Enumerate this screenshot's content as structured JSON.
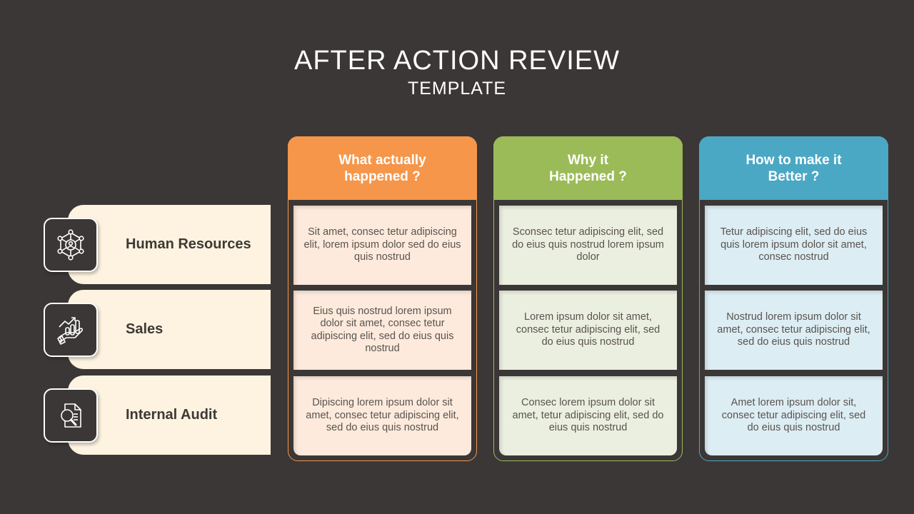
{
  "title": "AFTER ACTION REVIEW",
  "subtitle": "TEMPLATE",
  "colors": {
    "background": "#3b3736",
    "row_label_bg": "#fdf3e0",
    "orange": "#f5964a",
    "green": "#9bbb59",
    "blue": "#4aa8c4",
    "orange_cell": "#fdeadc",
    "green_cell": "#ebefdf",
    "blue_cell": "#dcedf3"
  },
  "rows": [
    {
      "label": "Human Resources",
      "icon": "network-people-icon"
    },
    {
      "label": "Sales",
      "icon": "hand-growth-chart-icon"
    },
    {
      "label": "Internal Audit",
      "icon": "document-search-icon"
    }
  ],
  "columns": [
    {
      "header": "What actually\nhappened ?",
      "cells": [
        "Sit amet, consec tetur adipiscing elit, lorem ipsum dolor  sed do eius quis nostrud",
        "Eius quis nostrud  lorem ipsum dolor sit amet, consec tetur adipiscing elit, sed do eius quis nostrud",
        "Dipiscing lorem ipsum dolor sit amet, consec tetur adipiscing elit, sed do eius quis nostrud"
      ]
    },
    {
      "header": "Why it\nHappened ?",
      "cells": [
        "Sconsec tetur adipiscing elit, sed do eius quis nostrud lorem ipsum dolor",
        "Lorem ipsum dolor sit amet, consec tetur adipiscing elit, sed do eius quis nostrud",
        "Consec lorem ipsum dolor sit amet, tetur adipiscing elit, sed do eius quis nostrud"
      ]
    },
    {
      "header": "How to make it\nBetter ?",
      "cells": [
        "Tetur adipiscing elit, sed do eius quis lorem ipsum dolor sit amet, consec nostrud",
        "Nostrud lorem ipsum dolor sit amet, consec tetur adipiscing elit, sed do eius quis nostrud",
        "Amet lorem ipsum dolor sit, consec tetur adipiscing elit, sed do eius quis nostrud"
      ]
    }
  ]
}
